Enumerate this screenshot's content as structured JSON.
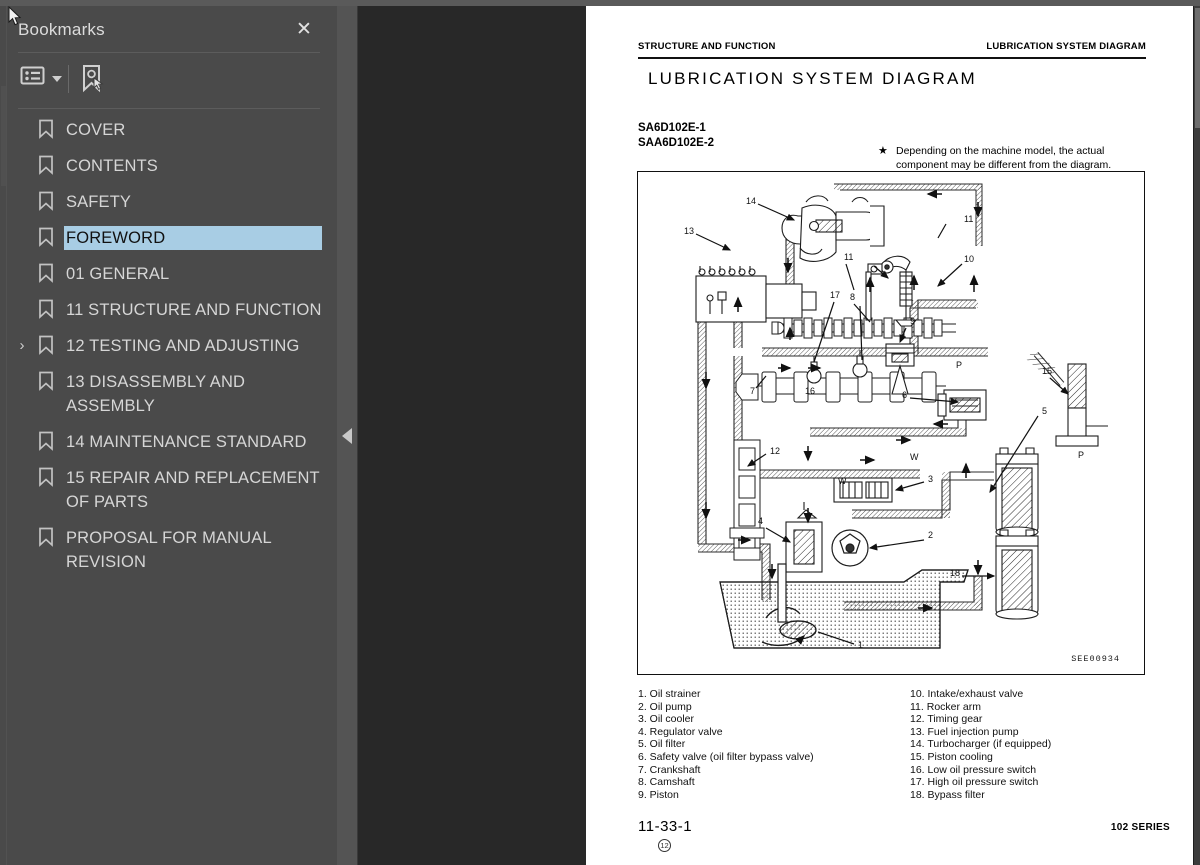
{
  "app": {
    "accent_selected": "#a8cde4",
    "panel_bg": "#4a4a4a",
    "viewer_bg": "#282828",
    "page_bg": "#ffffff"
  },
  "sidebar": {
    "title": "Bookmarks",
    "close_label": "✕",
    "toolbar": {
      "options_label": "list-options",
      "new_bookmark_label": "new-bookmark"
    },
    "items": [
      {
        "label": "COVER",
        "selected": false,
        "expandable": false
      },
      {
        "label": "CONTENTS",
        "selected": false,
        "expandable": false
      },
      {
        "label": "SAFETY",
        "selected": false,
        "expandable": false
      },
      {
        "label": "FOREWORD",
        "selected": true,
        "expandable": false
      },
      {
        "label": "01 GENERAL",
        "selected": false,
        "expandable": false
      },
      {
        "label": "11 STRUCTURE AND FUNCTION",
        "selected": false,
        "expandable": false
      },
      {
        "label": "12 TESTING AND ADJUSTING",
        "selected": false,
        "expandable": true
      },
      {
        "label": "13 DISASSEMBLY AND ASSEMBLY",
        "selected": false,
        "expandable": false
      },
      {
        "label": "14 MAINTENANCE STANDARD",
        "selected": false,
        "expandable": false
      },
      {
        "label": "15 REPAIR AND REPLACEMENT OF PARTS",
        "selected": false,
        "expandable": false
      },
      {
        "label": "PROPOSAL FOR MANUAL REVISION",
        "selected": false,
        "expandable": false
      }
    ]
  },
  "collapse_handle": {
    "label": "◀"
  },
  "document": {
    "header": {
      "left": "STRUCTURE AND FUNCTION",
      "right": "LUBRICATION SYSTEM DIAGRAM"
    },
    "title": "LUBRICATION  SYSTEM  DIAGRAM",
    "models": "SA6D102E-1\nSAA6D102E-2",
    "model_line1": "SA6D102E-1",
    "model_line2": "SAA6D102E-2",
    "note_marker": "★",
    "note": "Depending on the machine model, the actual component may be different from the diagram.",
    "figure_code": "SEE00934",
    "figure_callouts": [
      "1",
      "2",
      "3",
      "4",
      "5",
      "6",
      "7",
      "8",
      "9",
      "10",
      "11",
      "12",
      "13",
      "14",
      "15",
      "16",
      "17",
      "18",
      "W",
      "W",
      "P",
      "P"
    ],
    "legend_col1": [
      "1. Oil strainer",
      "2. Oil pump",
      "3. Oil cooler",
      "4. Regulator valve",
      "5. Oil filter",
      "6. Safety valve (oil filter bypass valve)",
      "7. Crankshaft",
      "8. Camshaft",
      "9. Piston"
    ],
    "legend_col2": [
      "10. Intake/exhaust valve",
      "11. Rocker arm",
      "12. Timing gear",
      "13. Fuel injection pump",
      "14. Turbocharger  (if equipped)",
      "15. Piston cooling",
      "16. Low oil pressure switch",
      "17. High oil pressure switch",
      "18. Bypass filter"
    ],
    "footer": {
      "page_number": "11-33-1",
      "revision_mark": "12",
      "series": "102 SERIES"
    }
  }
}
